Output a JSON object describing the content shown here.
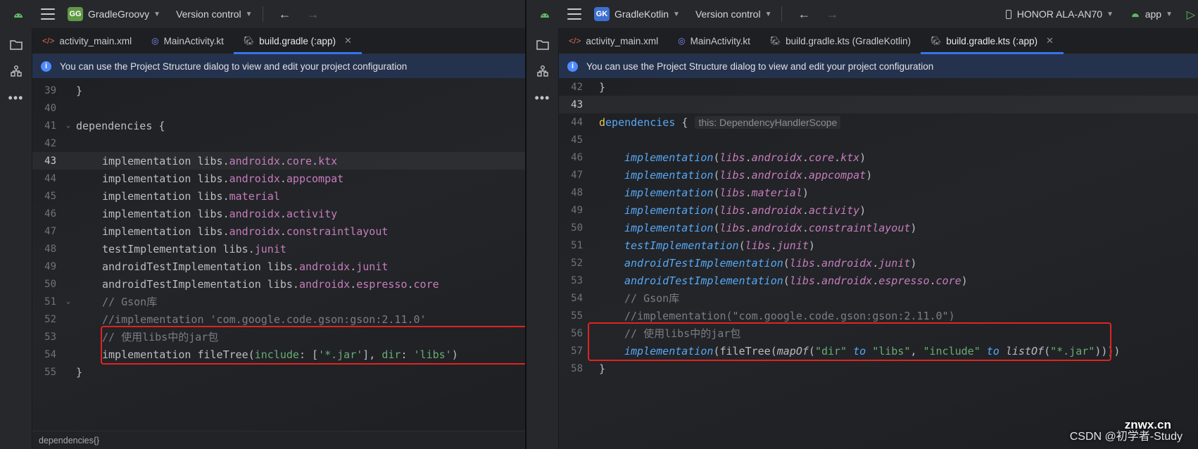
{
  "left": {
    "project_badge": "GG",
    "project_badge_color": "#5f9945",
    "project_name": "GradleGroovy",
    "version_control": "Version control",
    "tabs": [
      {
        "icon": "xml-file-icon",
        "label": "activity_main.xml",
        "color": "#e06c4b"
      },
      {
        "icon": "kotlin-file-icon",
        "label": "MainActivity.kt",
        "color": "#7f8dff"
      },
      {
        "icon": "gradle-file-icon",
        "label": "build.gradle (:app)",
        "color": "#b0b3b9"
      }
    ],
    "active_tab": 2,
    "banner": "You can use the Project Structure dialog to view and edit your project configuration",
    "line_numbers": [
      "39",
      "40",
      "41",
      "42",
      "43",
      "44",
      "45",
      "46",
      "47",
      "48",
      "49",
      "50",
      "51",
      "52",
      "53",
      "54",
      "55"
    ],
    "current_line": "43",
    "status": "dependencies{}"
  },
  "right": {
    "project_badge": "GK",
    "project_badge_color": "#3d6fd1",
    "project_name": "GradleKotlin",
    "version_control": "Version control",
    "device": "HONOR ALA-AN70",
    "run_config": "app",
    "tabs": [
      {
        "icon": "xml-file-icon",
        "label": "activity_main.xml",
        "color": "#e06c4b"
      },
      {
        "icon": "kotlin-file-icon",
        "label": "MainActivity.kt",
        "color": "#7f8dff"
      },
      {
        "icon": "gradle-kts-file-icon",
        "label": "build.gradle.kts (GradleKotlin)",
        "color": "#b0b3b9"
      },
      {
        "icon": "gradle-kts-file-icon",
        "label": "build.gradle.kts (:app)",
        "color": "#b0b3b9"
      }
    ],
    "active_tab": 3,
    "banner": "You can use the Project Structure dialog to view and edit your project configuration",
    "line_numbers": [
      "42",
      "43",
      "44",
      "45",
      "46",
      "47",
      "48",
      "49",
      "50",
      "51",
      "52",
      "53",
      "54",
      "55",
      "56",
      "57",
      "58"
    ],
    "current_line": "43",
    "type_hint": "this: DependencyHandlerScope"
  },
  "watermark": "CSDN @初学者-Study",
  "watermark_overlay": "znwx.cn"
}
